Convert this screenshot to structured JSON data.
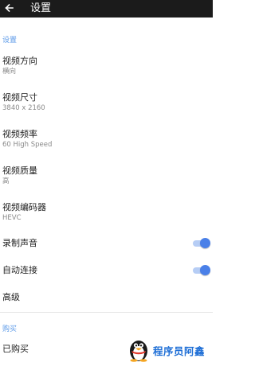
{
  "header": {
    "title": "设置",
    "back_icon": "arrow-left-icon"
  },
  "sections": {
    "settings": {
      "header": "设置"
    },
    "purchase": {
      "header": "购买"
    }
  },
  "items": {
    "orientation": {
      "label": "视频方向",
      "value": "横向"
    },
    "size": {
      "label": "视频尺寸",
      "value": "3840 x 2160"
    },
    "framerate": {
      "label": "视频频率",
      "value": "60 High Speed"
    },
    "quality": {
      "label": "视频质量",
      "value": "高"
    },
    "encoder": {
      "label": "视频编码器",
      "value": "HEVC"
    },
    "record_audio": {
      "label": "录制声音",
      "enabled": true
    },
    "auto_connect": {
      "label": "自动连接",
      "enabled": true
    },
    "advanced": {
      "label": "高级"
    },
    "purchased": {
      "label": "已购买"
    }
  },
  "watermark": {
    "text": "程序员阿鑫"
  },
  "colors": {
    "accent": "#4a80e8",
    "section_header": "#5c9ae8",
    "appbar": "#1b1b1b"
  }
}
